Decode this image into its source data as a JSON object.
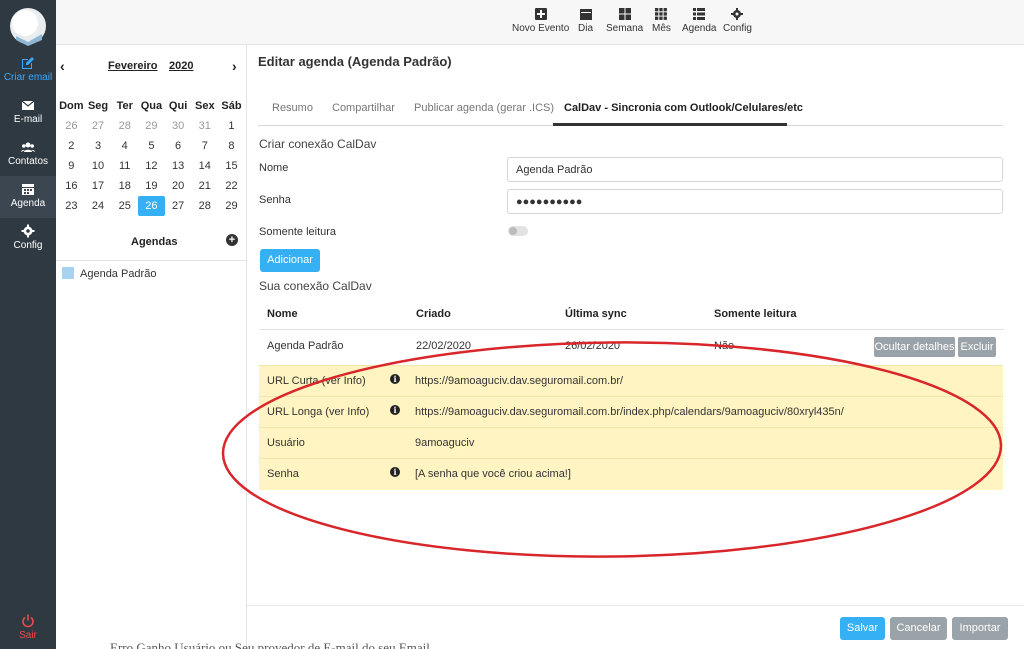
{
  "nav": {
    "items": [
      {
        "label": "Criar email",
        "icon": "edit-icon"
      },
      {
        "label": "E-mail",
        "icon": "envelope-icon"
      },
      {
        "label": "Contatos",
        "icon": "users-icon"
      },
      {
        "label": "Agenda",
        "icon": "calendar-icon"
      },
      {
        "label": "Config",
        "icon": "gear-icon"
      }
    ],
    "logout_label": "Sair"
  },
  "calendar": {
    "month": "Fevereiro",
    "year": "2020",
    "weekdays": [
      "Dom",
      "Seg",
      "Ter",
      "Qua",
      "Qui",
      "Sex",
      "Sáb"
    ],
    "weeks": [
      [
        "26",
        "27",
        "28",
        "29",
        "30",
        "31",
        "1"
      ],
      [
        "2",
        "3",
        "4",
        "5",
        "6",
        "7",
        "8"
      ],
      [
        "9",
        "10",
        "11",
        "12",
        "13",
        "14",
        "15"
      ],
      [
        "16",
        "17",
        "18",
        "19",
        "20",
        "21",
        "22"
      ],
      [
        "23",
        "24",
        "25",
        "26",
        "27",
        "28",
        "29"
      ]
    ],
    "selected_day": "26"
  },
  "agendas": {
    "title": "Agendas",
    "items": [
      "Agenda Padrão"
    ]
  },
  "toolbar": {
    "buttons": [
      {
        "label": "Novo Evento",
        "icon": "plus-square-icon"
      },
      {
        "label": "Dia",
        "icon": "calendar-day-icon"
      },
      {
        "label": "Semana",
        "icon": "grid-week-icon"
      },
      {
        "label": "Mês",
        "icon": "grid-month-icon"
      },
      {
        "label": "Agenda",
        "icon": "list-icon"
      },
      {
        "label": "Config",
        "icon": "gear-icon"
      }
    ]
  },
  "main": {
    "title": "Editar agenda (Agenda Padrão)",
    "tabs": [
      {
        "label": "Resumo"
      },
      {
        "label": "Compartilhar"
      },
      {
        "label": "Publicar agenda (gerar .ICS)"
      },
      {
        "label": "CalDav - Sincronia com Outlook/Celulares/etc"
      }
    ],
    "create": {
      "title": "Criar conexão CalDav",
      "name_label": "Nome",
      "name_value": "Agenda Padrão",
      "password_label": "Senha",
      "password_value": "●●●●●●●●●●",
      "readonly_label": "Somente leitura",
      "add_button": "Adicionar"
    },
    "connections": {
      "title": "Sua conexão CalDav",
      "headers": [
        "Nome",
        "Criado",
        "Última sync",
        "Somente leitura"
      ],
      "row": {
        "name": "Agenda Padrão",
        "created": "22/02/2020",
        "last_sync": "26/02/2020",
        "readonly": "Não"
      },
      "hide_details": "Ocultar detalhes",
      "delete": "Excluir",
      "details": [
        {
          "key": "URL Curta (ver Info)",
          "value": "https://9amoaguciv.dav.seguromail.com.br/",
          "info": true
        },
        {
          "key": "URL Longa (ver Info)",
          "value": "https://9amoaguciv.dav.seguromail.com.br/index.php/calendars/9amoaguciv/80xryl435n/",
          "info": true
        },
        {
          "key": "Usuário",
          "value": "9amoaguciv",
          "info": false
        },
        {
          "key": "Senha",
          "value": "[A senha que você criou acima!]",
          "info": true
        }
      ]
    }
  },
  "footer": {
    "save": "Salvar",
    "cancel": "Cancelar",
    "import": "Importar"
  },
  "bottom_text": "Erro Ganho Usuário ou Seu provedor de E-mail do seu Email",
  "colors": {
    "accent": "#35b0f5",
    "nav_bg": "#2f3941",
    "highlight": "#fff4c2",
    "annotation": "#d8262b"
  }
}
